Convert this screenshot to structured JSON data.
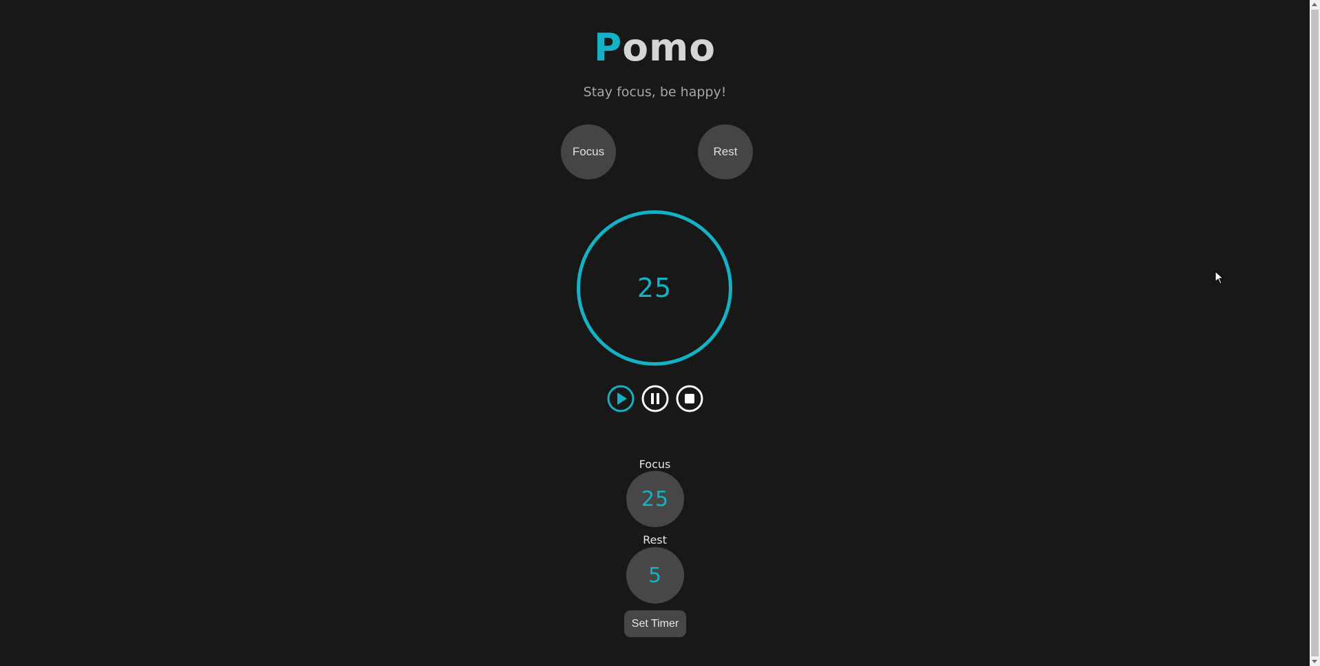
{
  "header": {
    "title_accent": "P",
    "title_rest": "omo",
    "subtitle": "Stay focus, be happy!"
  },
  "modes": {
    "focus_label": "Focus",
    "rest_label": "Rest"
  },
  "timer": {
    "display": "25"
  },
  "controls": {
    "play_icon": "play-icon",
    "pause_icon": "pause-icon",
    "stop_icon": "stop-icon"
  },
  "settings": {
    "focus_label": "Focus",
    "focus_value": "25",
    "rest_label": "Rest",
    "rest_value": "5",
    "set_button_label": "Set Timer"
  },
  "colors": {
    "background": "#181818",
    "accent": "#14b2c4",
    "surface": "#454545",
    "title_text": "#d5d5d5"
  }
}
